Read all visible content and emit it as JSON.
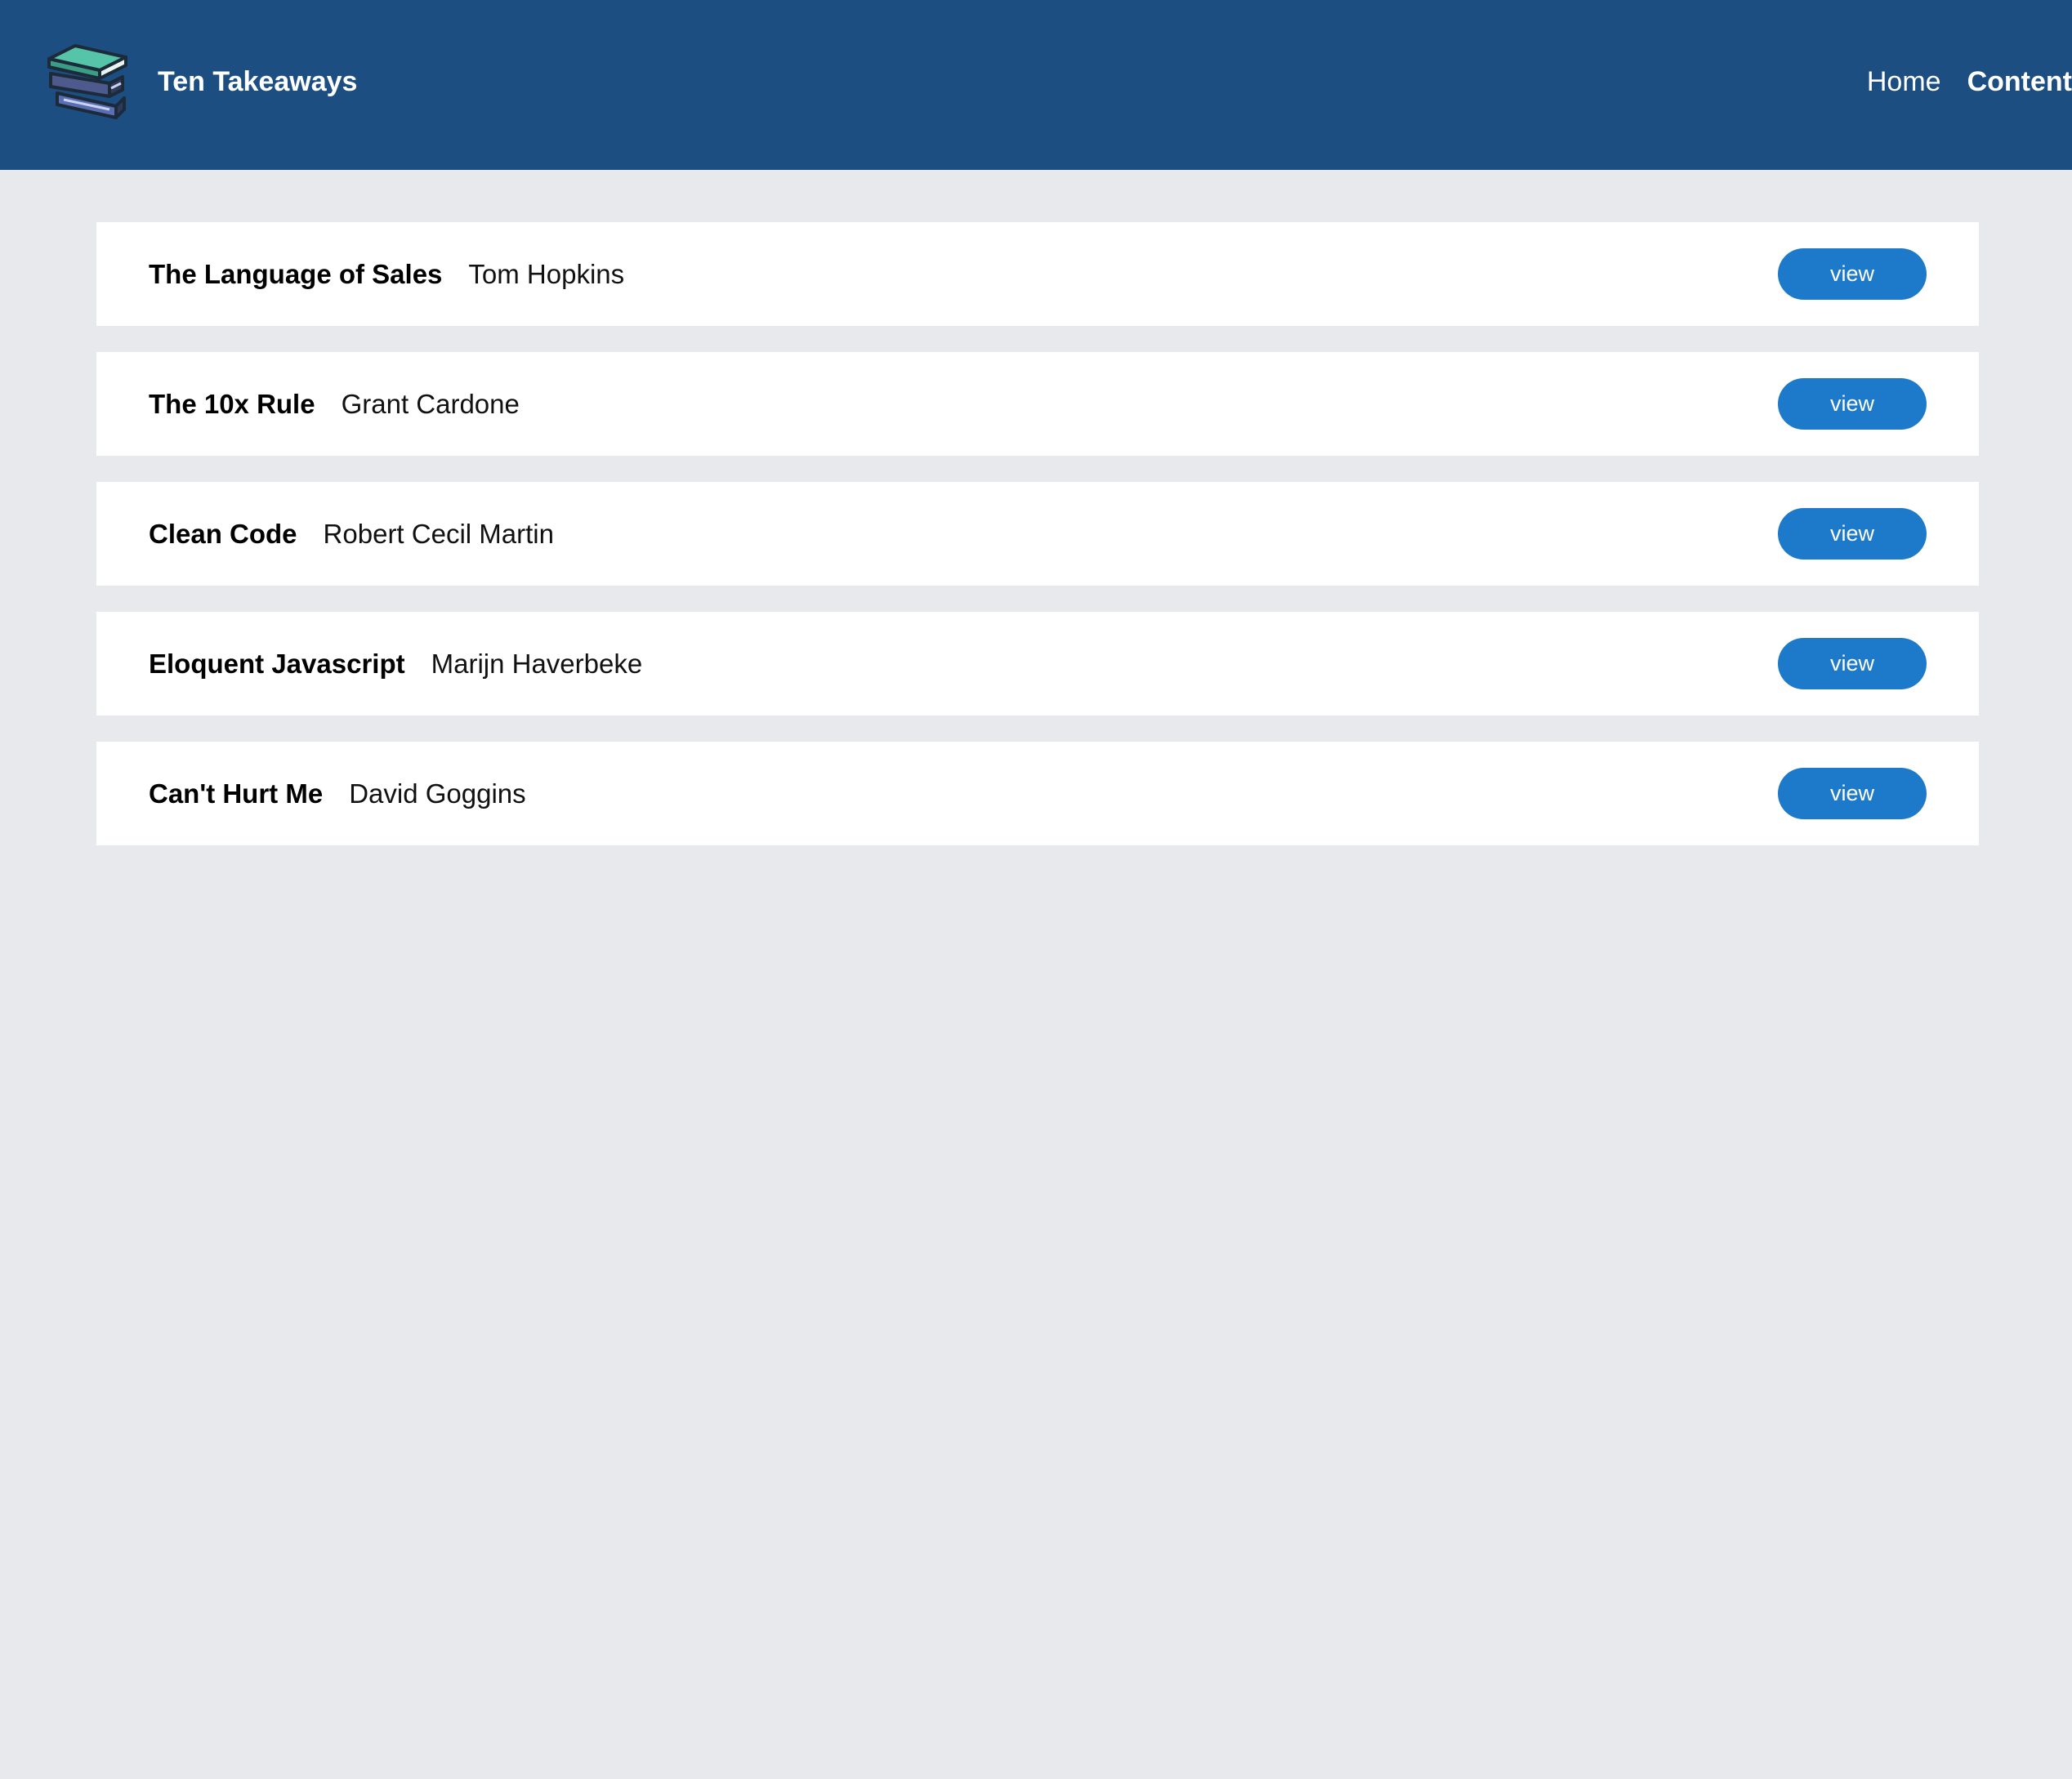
{
  "header": {
    "brand": "Ten Takeaways",
    "logo_icon": "books-stack-icon",
    "nav": [
      {
        "label": "Home",
        "active": false
      },
      {
        "label": "Content",
        "active": true
      }
    ]
  },
  "books": [
    {
      "title": "The Language of Sales",
      "author": "Tom Hopkins",
      "button": "view"
    },
    {
      "title": "The 10x Rule",
      "author": "Grant Cardone",
      "button": "view"
    },
    {
      "title": "Clean Code",
      "author": "Robert Cecil Martin",
      "button": "view"
    },
    {
      "title": "Eloquent Javascript",
      "author": "Marijn Haverbeke",
      "button": "view"
    },
    {
      "title": "Can't Hurt Me",
      "author": "David Goggins",
      "button": "view"
    }
  ],
  "colors": {
    "header_bg": "#1c4e82",
    "page_bg": "#e8e9ed",
    "button_bg": "#1d79c9",
    "card_bg": "#ffffff"
  }
}
